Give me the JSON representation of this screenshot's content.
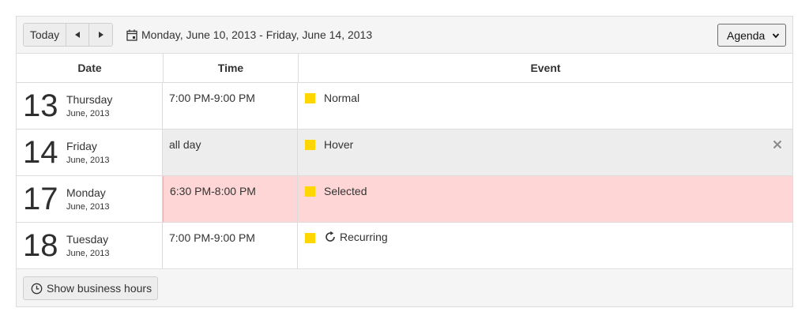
{
  "toolbar": {
    "today_label": "Today",
    "date_range": "Monday, June 10, 2013 - Friday, June 14, 2013",
    "view_select": {
      "selected": "Agenda",
      "options": [
        "Agenda"
      ]
    }
  },
  "table": {
    "headers": {
      "date": "Date",
      "time": "Time",
      "event": "Event"
    },
    "rows": [
      {
        "day": "13",
        "weekday": "Thursday",
        "month_year": "June, 2013",
        "time": "7:00 PM-9:00 PM",
        "event": "Normal",
        "state": "normal"
      },
      {
        "day": "14",
        "weekday": "Friday",
        "month_year": "June, 2013",
        "time": "all day",
        "event": "Hover",
        "state": "hover"
      },
      {
        "day": "17",
        "weekday": "Monday",
        "month_year": "June, 2013",
        "time": "6:30 PM-8:00 PM",
        "event": "Selected",
        "state": "selected"
      },
      {
        "day": "18",
        "weekday": "Tuesday",
        "month_year": "June, 2013",
        "time": "7:00 PM-9:00 PM",
        "event": "Recurring",
        "state": "recurring"
      }
    ]
  },
  "footer": {
    "business_hours_label": "Show business hours"
  },
  "colors": {
    "event_swatch": "#ffd600",
    "hover_bg": "#ededed",
    "selected_bg": "#ffd6d6"
  },
  "icons": [
    "calendar-icon",
    "arrow-left-icon",
    "arrow-right-icon",
    "chevron-down-icon",
    "close-icon",
    "recurrence-icon",
    "clock-icon"
  ]
}
